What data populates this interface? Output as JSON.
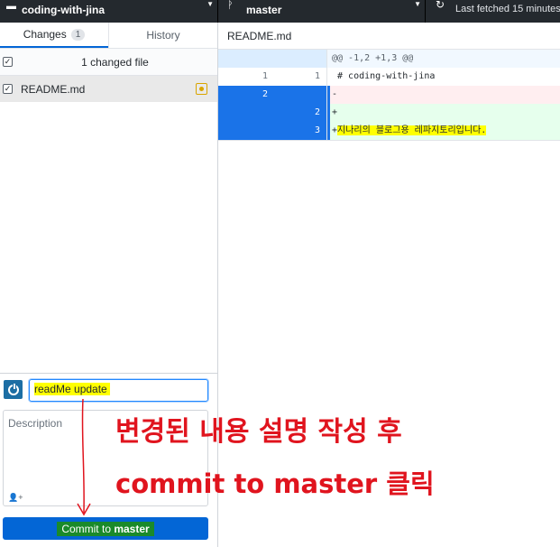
{
  "topbar": {
    "repo_name": "coding-with-jina",
    "branch_name": "master",
    "fetch_status": "Last fetched 15 minutes"
  },
  "tabs": [
    {
      "label": "Changes",
      "count": "1",
      "active": true
    },
    {
      "label": "History",
      "active": false
    }
  ],
  "changes": {
    "summary": "1 changed file",
    "files": [
      {
        "name": "README.md",
        "status": "modified"
      }
    ]
  },
  "diff": {
    "file_name": "README.md",
    "hunk_header": "@@ -1,2 +1,3 @@",
    "lines": [
      {
        "type": "context",
        "old": "1",
        "new": "1",
        "text": " # coding-with-jina"
      },
      {
        "type": "del",
        "old": "2",
        "new": "",
        "text": "-"
      },
      {
        "type": "add",
        "old": "",
        "new": "2",
        "text": "+"
      },
      {
        "type": "add",
        "old": "",
        "new": "3",
        "prefix": "+",
        "text": "지나리의 블로그용 레파지토리입니다."
      }
    ]
  },
  "commit": {
    "summary_value": "readMe update",
    "description_placeholder": "Description",
    "button_label_prefix": "Commit to ",
    "button_label_branch": "master"
  },
  "annotations": {
    "line1": "변경된 내용 설명 작성 후",
    "line2": "commit to master 클릭"
  },
  "colors": {
    "accent": "#0366d6",
    "annotation": "#e0141e",
    "highlight": "#ffff00"
  }
}
